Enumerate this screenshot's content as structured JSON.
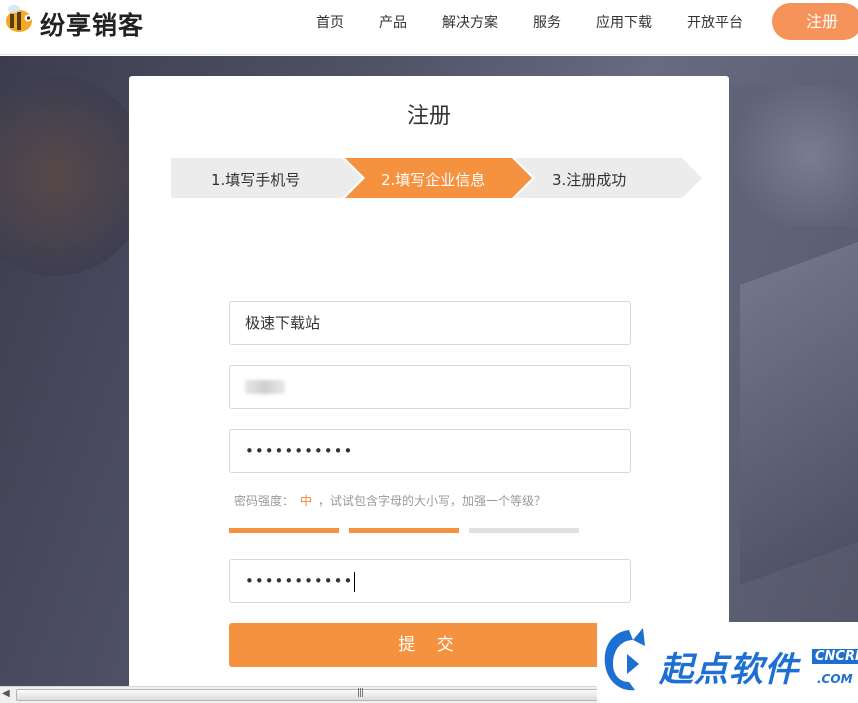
{
  "header": {
    "brand": "纷享销客",
    "nav": [
      {
        "label": "首页"
      },
      {
        "label": "产品"
      },
      {
        "label": "解决方案"
      },
      {
        "label": "服务"
      },
      {
        "label": "应用下载"
      },
      {
        "label": "开放平台"
      }
    ],
    "register_button": "注册"
  },
  "card": {
    "title": "注册",
    "steps": [
      {
        "label": "1.填写手机号",
        "active": false
      },
      {
        "label": "2.填写企业信息",
        "active": true
      },
      {
        "label": "3.注册成功",
        "active": false
      }
    ],
    "fields": {
      "company_value": "极速下载站",
      "password_value": "•••••••••••",
      "confirm_value": "•••••••••••"
    },
    "strength": {
      "prefix": "密码强度：",
      "level": "中",
      "hint": "，试试包含字母的大小写，加强一个等级？",
      "filled_segments": 2,
      "total_segments": 3
    },
    "submit_label": "提 交"
  },
  "watermark": {
    "text": "起点软件",
    "cn": "CNCRK",
    "com": ".COM"
  },
  "colors": {
    "accent": "#f5923f",
    "step_inactive": "#ececec",
    "bar_empty": "#e0e0e0",
    "watermark_blue": "#1d6fd1"
  }
}
